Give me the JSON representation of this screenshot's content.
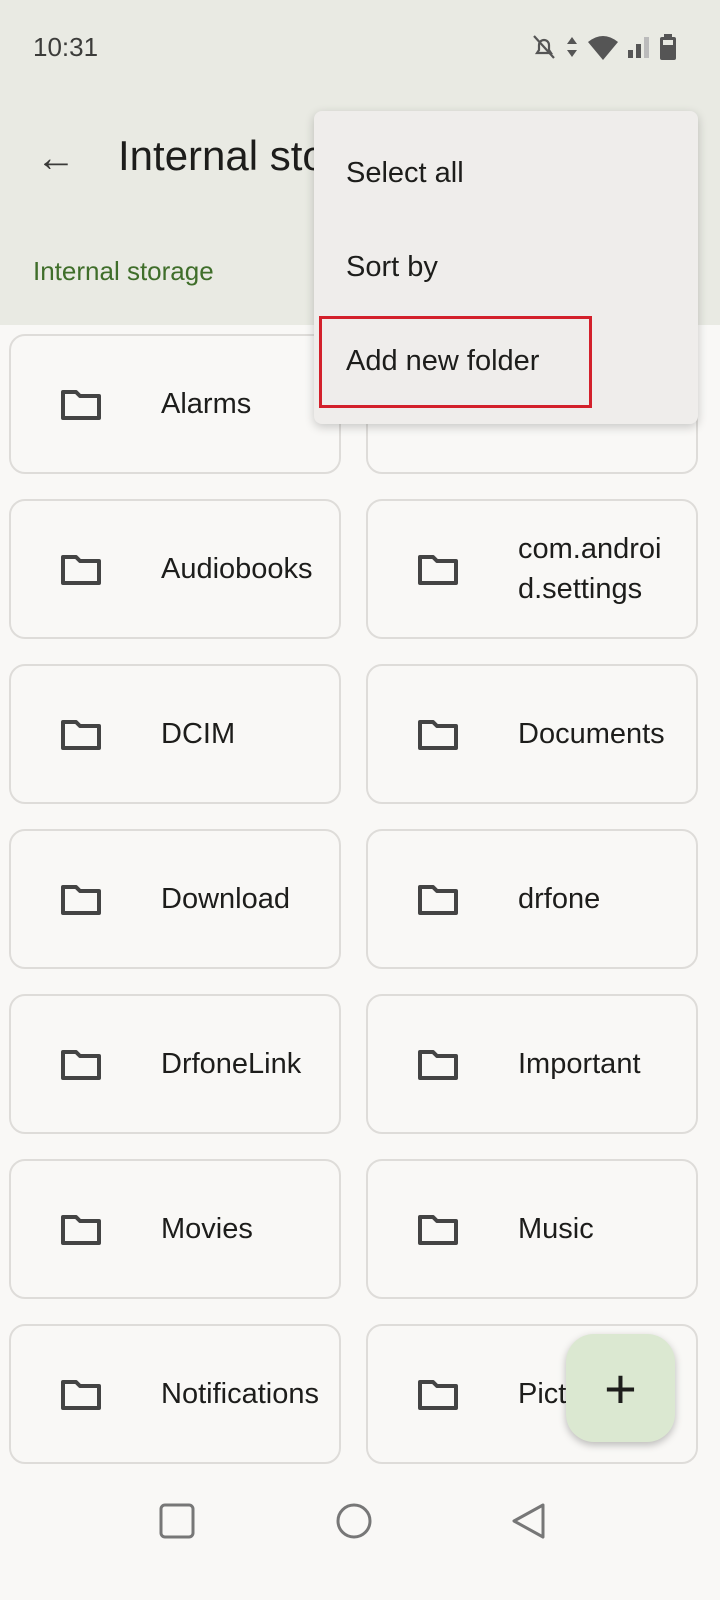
{
  "status_bar": {
    "time": "10:31",
    "icons": [
      "bell-off-icon",
      "data-arrows-icon",
      "wifi-icon",
      "signal-icon",
      "battery-icon"
    ]
  },
  "header": {
    "title": "Internal storage",
    "breadcrumb": "Internal storage"
  },
  "menu": {
    "items": [
      "Select all",
      "Sort by",
      "Add new folder"
    ],
    "highlighted": "Add new folder",
    "highlight_color": "#d3202b"
  },
  "folders": [
    "Alarms",
    "",
    "Audiobooks",
    "com.android.settings",
    "DCIM",
    "Documents",
    "Download",
    "drfone",
    "DrfoneLink",
    "Important",
    "Movies",
    "Music",
    "Notifications",
    "Pictures"
  ],
  "fab": {
    "label": "+"
  },
  "colors": {
    "accent": "#3f6e2a",
    "fab": "#dbe8d1"
  }
}
